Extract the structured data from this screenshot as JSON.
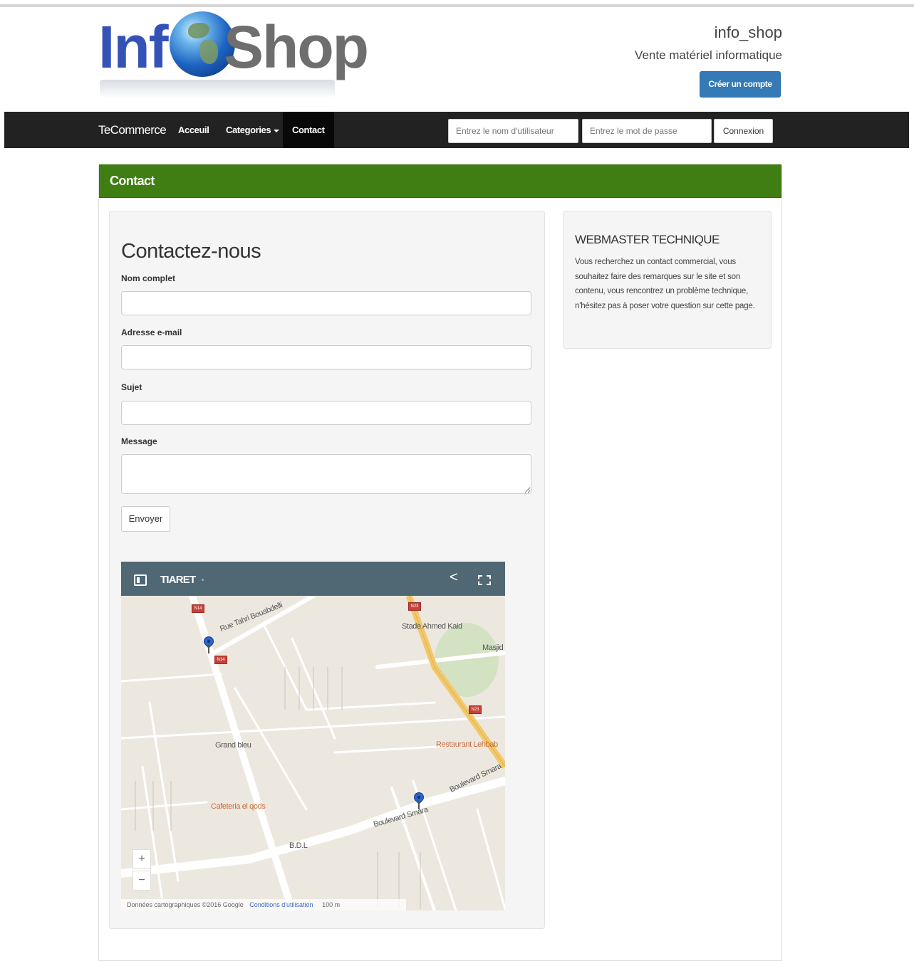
{
  "header": {
    "logo_text_left": "Inf",
    "logo_text_right": "Shop",
    "site_name": "info_shop",
    "tagline": "Vente matériel informatique",
    "create_account_label": "Créer un compte",
    "accent_color": "#337ab7"
  },
  "navbar": {
    "brand": "TeCommerce",
    "items": [
      {
        "label": "Acceuil"
      },
      {
        "label": "Categories"
      },
      {
        "label": "Contact",
        "active": true
      }
    ],
    "username_placeholder": "Entrez le nom d'utilisateur",
    "password_placeholder": "Entrez le mot de passe",
    "login_label": "Connexion"
  },
  "panel": {
    "heading": "Contact",
    "heading_color": "#3e7e12"
  },
  "form": {
    "title": "Contactez-nous",
    "fields": [
      {
        "label": "Nom complet",
        "value": ""
      },
      {
        "label": "Adresse e-mail",
        "value": ""
      },
      {
        "label": "Sujet",
        "value": ""
      },
      {
        "label": "Message",
        "value": ""
      }
    ],
    "submit_label": "Envoyer"
  },
  "map": {
    "title": "TIARET",
    "labels": {
      "street1": "Rue Tahri Bouabdelli",
      "stadium": "Stade Ahmed Kaid",
      "mosque": "Masjid",
      "grand_bleu": "Grand bleu",
      "restaurant": "Restaurant Lehbab",
      "smara1": "Boulevard Smara",
      "cafeteria": "Cafeteria el qods",
      "smara2": "Boulevard Smara",
      "bdl": "B.D.L",
      "road_n1": "N14",
      "road_n2": "N23",
      "road_n3": "N14",
      "road_n4": "N23"
    },
    "zoom_in": "+",
    "zoom_out": "−",
    "footer_copyright": "Données cartographiques ©2016 Google",
    "footer_terms": "Conditions d'utilisation",
    "footer_scale": "100 m"
  },
  "sidebar": {
    "title": "WEBMASTER TECHNIQUE",
    "text": "Vous recherchez un contact commercial, vous souhaitez faire des remarques sur le site et son contenu, vous rencontrez un problème technique, n'hésitez pas à poser votre question sur cette page."
  }
}
